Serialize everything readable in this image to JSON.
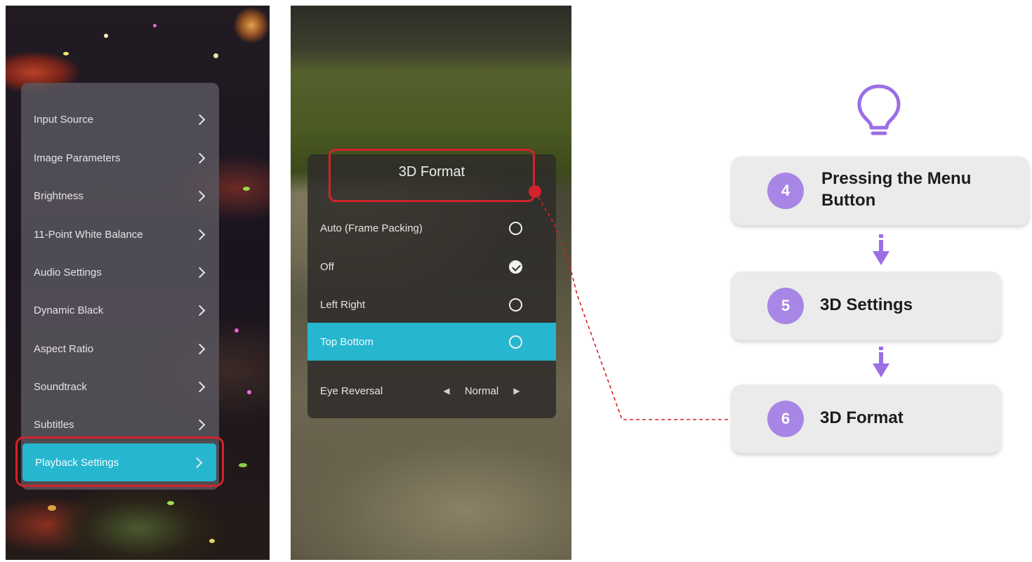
{
  "main_menu": {
    "items": [
      {
        "label": "Input Source"
      },
      {
        "label": "Image Parameters"
      },
      {
        "label": "Brightness"
      },
      {
        "label": "11-Point White Balance"
      },
      {
        "label": "Audio Settings"
      },
      {
        "label": "Dynamic Black"
      },
      {
        "label": "Aspect Ratio"
      },
      {
        "label": "Soundtrack"
      },
      {
        "label": "Subtitles"
      },
      {
        "label": "Playback Settings",
        "selected": true
      }
    ]
  },
  "format_menu": {
    "title": "3D Format",
    "options": [
      {
        "label": "Auto (Frame Packing)",
        "checked": false
      },
      {
        "label": "Off",
        "checked": true
      },
      {
        "label": "Left Right",
        "checked": false
      },
      {
        "label": "Top Bottom",
        "checked": false,
        "selected": true
      }
    ],
    "eye_reversal": {
      "label": "Eye Reversal",
      "value": "Normal"
    }
  },
  "steps": [
    {
      "number": "4",
      "label": "Pressing the Menu Button"
    },
    {
      "number": "5",
      "label": "3D Settings"
    },
    {
      "number": "6",
      "label": "3D Format"
    }
  ],
  "colors": {
    "accent_cyan": "#26b6cf",
    "highlight_red": "#d2232a",
    "step_purple": "#a786e6",
    "card_gray": "#ebebeb"
  },
  "icons": {
    "tip": "lightbulb-icon",
    "flow": "arrow-down-icon",
    "nav": "chevron-right-icon"
  }
}
